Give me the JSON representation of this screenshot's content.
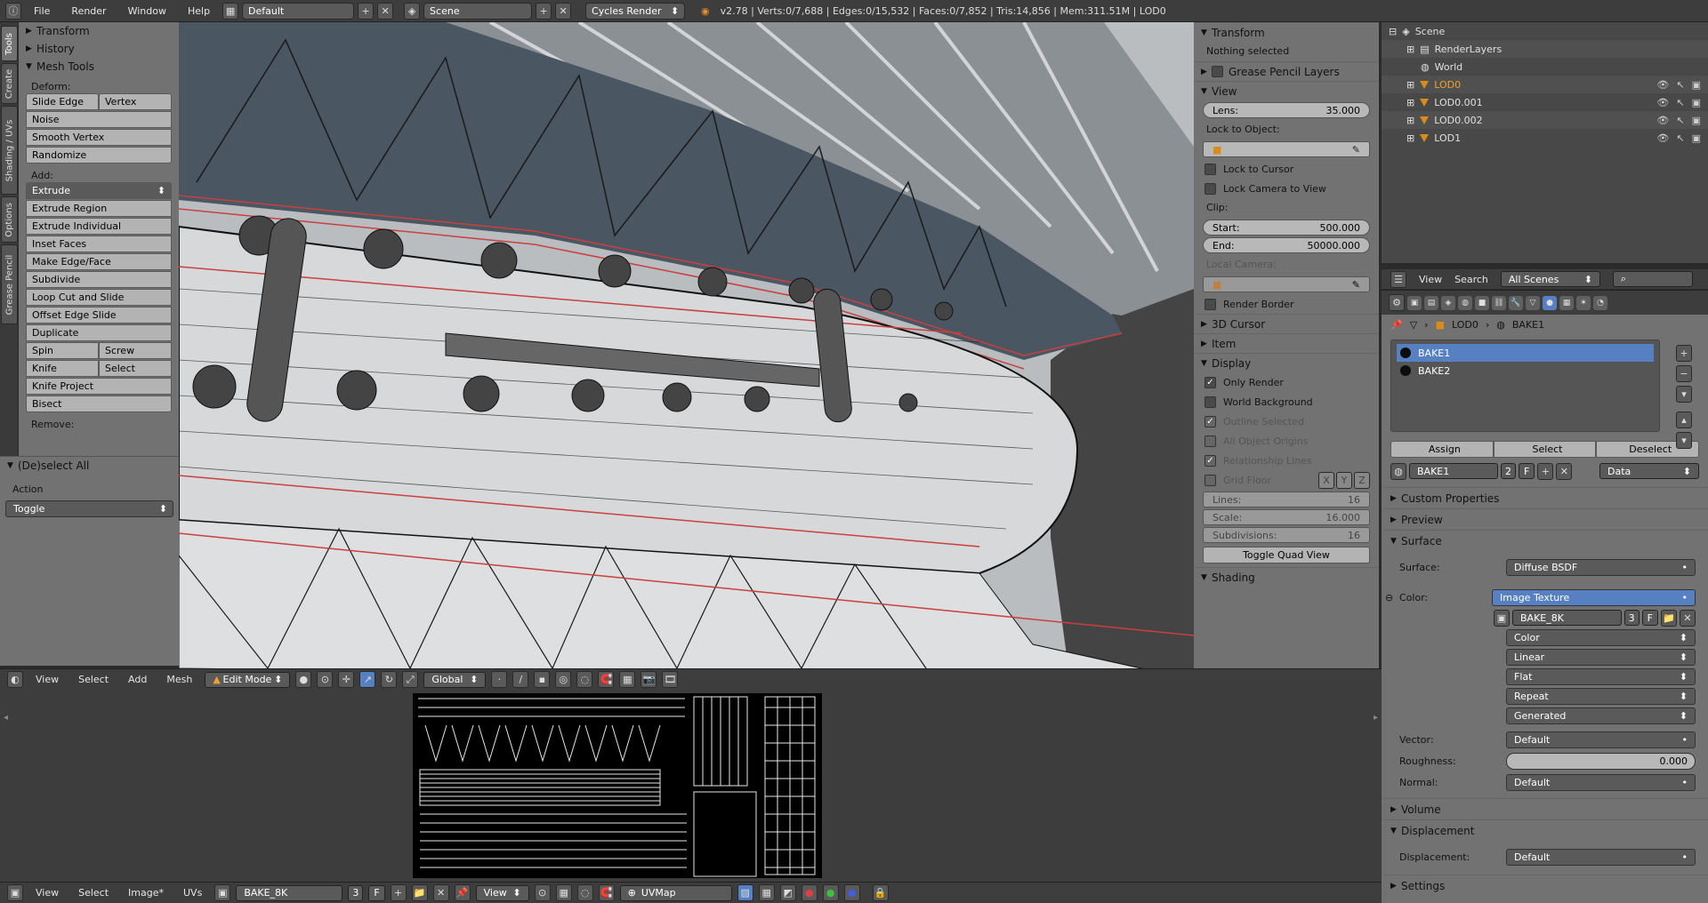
{
  "topbar": {
    "menus": [
      "File",
      "Render",
      "Window",
      "Help"
    ],
    "layout": "Default",
    "scene": "Scene",
    "engine": "Cycles Render",
    "stats": "v2.78 | Verts:0/7,688 | Edges:0/15,532 | Faces:0/7,852 | Tris:14,856 | Mem:311.51M | LOD0"
  },
  "tabs": [
    "Tools",
    "Create",
    "Shading / UVs",
    "Options",
    "Grease Pencil"
  ],
  "toolshelf": {
    "transform": "Transform",
    "history": "History",
    "mesh_tools": "Mesh Tools",
    "deform_label": "Deform:",
    "slide_edge": "Slide Edge",
    "vertex": "Vertex",
    "noise": "Noise",
    "smooth_vertex": "Smooth Vertex",
    "randomize": "Randomize",
    "add_label": "Add:",
    "extrude": "Extrude",
    "extrude_region": "Extrude Region",
    "extrude_individual": "Extrude Individual",
    "inset_faces": "Inset Faces",
    "make_edge_face": "Make Edge/Face",
    "subdivide": "Subdivide",
    "loop_cut": "Loop Cut and Slide",
    "offset_edge": "Offset Edge Slide",
    "duplicate": "Duplicate",
    "spin": "Spin",
    "screw": "Screw",
    "knife": "Knife",
    "select": "Select",
    "knife_project": "Knife Project",
    "bisect": "Bisect",
    "remove_label": "Remove:"
  },
  "operator": {
    "title": "(De)select All",
    "action_label": "Action",
    "action_value": "Toggle"
  },
  "npanel": {
    "transform": "Transform",
    "nothing_selected": "Nothing selected",
    "grease_pencil": "Grease Pencil Layers",
    "view": "View",
    "lens_label": "Lens:",
    "lens_value": "35.000",
    "lock_to_object": "Lock to Object:",
    "lock_cursor": "Lock to Cursor",
    "lock_camera": "Lock Camera to View",
    "clip": "Clip:",
    "start_label": "Start:",
    "start_value": "500.000",
    "end_label": "End:",
    "end_value": "50000.000",
    "local_camera": "Local Camera:",
    "render_border": "Render Border",
    "cursor": "3D Cursor",
    "item": "Item",
    "display": "Display",
    "only_render": "Only Render",
    "world_bg": "World Background",
    "outline_sel": "Outline Selected",
    "all_origins": "All Object Origins",
    "rel_lines": "Relationship Lines",
    "grid_floor": "Grid Floor",
    "x": "X",
    "y": "Y",
    "z": "Z",
    "lines_label": "Lines:",
    "lines_value": "16",
    "scale_label": "Scale:",
    "scale_value": "16.000",
    "subdiv_label": "Subdivisions:",
    "subdiv_value": "16",
    "quad_view": "Toggle Quad View",
    "shading": "Shading"
  },
  "outliner": {
    "scene": "Scene",
    "render_layers": "RenderLayers",
    "world": "World",
    "objects": [
      "LOD0",
      "LOD0.001",
      "LOD0.002",
      "LOD1"
    ]
  },
  "ol_header": {
    "view": "View",
    "search": "Search",
    "filter": "All Scenes"
  },
  "properties": {
    "crumb_object": "LOD0",
    "crumb_material": "BAKE1",
    "slots": [
      "BAKE1",
      "BAKE2"
    ],
    "assign": "Assign",
    "select": "Select",
    "deselect": "Deselect",
    "material_name": "BAKE1",
    "material_users": "2",
    "f_label": "F",
    "data_label": "Data",
    "custom_props": "Custom Properties",
    "preview": "Preview",
    "surface_section": "Surface",
    "surface_label": "Surface:",
    "surface_value": "Diffuse BSDF",
    "color_label": "Color:",
    "color_value": "Image Texture",
    "image_name": "BAKE_8K",
    "image_users": "3",
    "opt_color": "Color",
    "opt_linear": "Linear",
    "opt_flat": "Flat",
    "opt_repeat": "Repeat",
    "opt_generated": "Generated",
    "vector_label": "Vector:",
    "vector_value": "Default",
    "roughness_label": "Roughness:",
    "roughness_value": "0.000",
    "normal_label": "Normal:",
    "normal_value": "Default",
    "volume": "Volume",
    "displacement_section": "Displacement",
    "displacement_label": "Displacement:",
    "displacement_value": "Default",
    "settings": "Settings"
  },
  "vp_header": {
    "view": "View",
    "select": "Select",
    "add": "Add",
    "mesh": "Mesh",
    "mode": "Edit Mode",
    "orientation": "Global"
  },
  "img_header": {
    "view": "View",
    "select": "Select",
    "image": "Image*",
    "uvs": "UVs",
    "image_name": "BAKE_8K",
    "users": "3",
    "f": "F",
    "view_mode": "View",
    "uvmap": "UVMap"
  },
  "colors": {
    "accent": "#5680c2",
    "object_orange": "#d98c1a",
    "panel": "#727272",
    "header": "#3d3d3d"
  }
}
